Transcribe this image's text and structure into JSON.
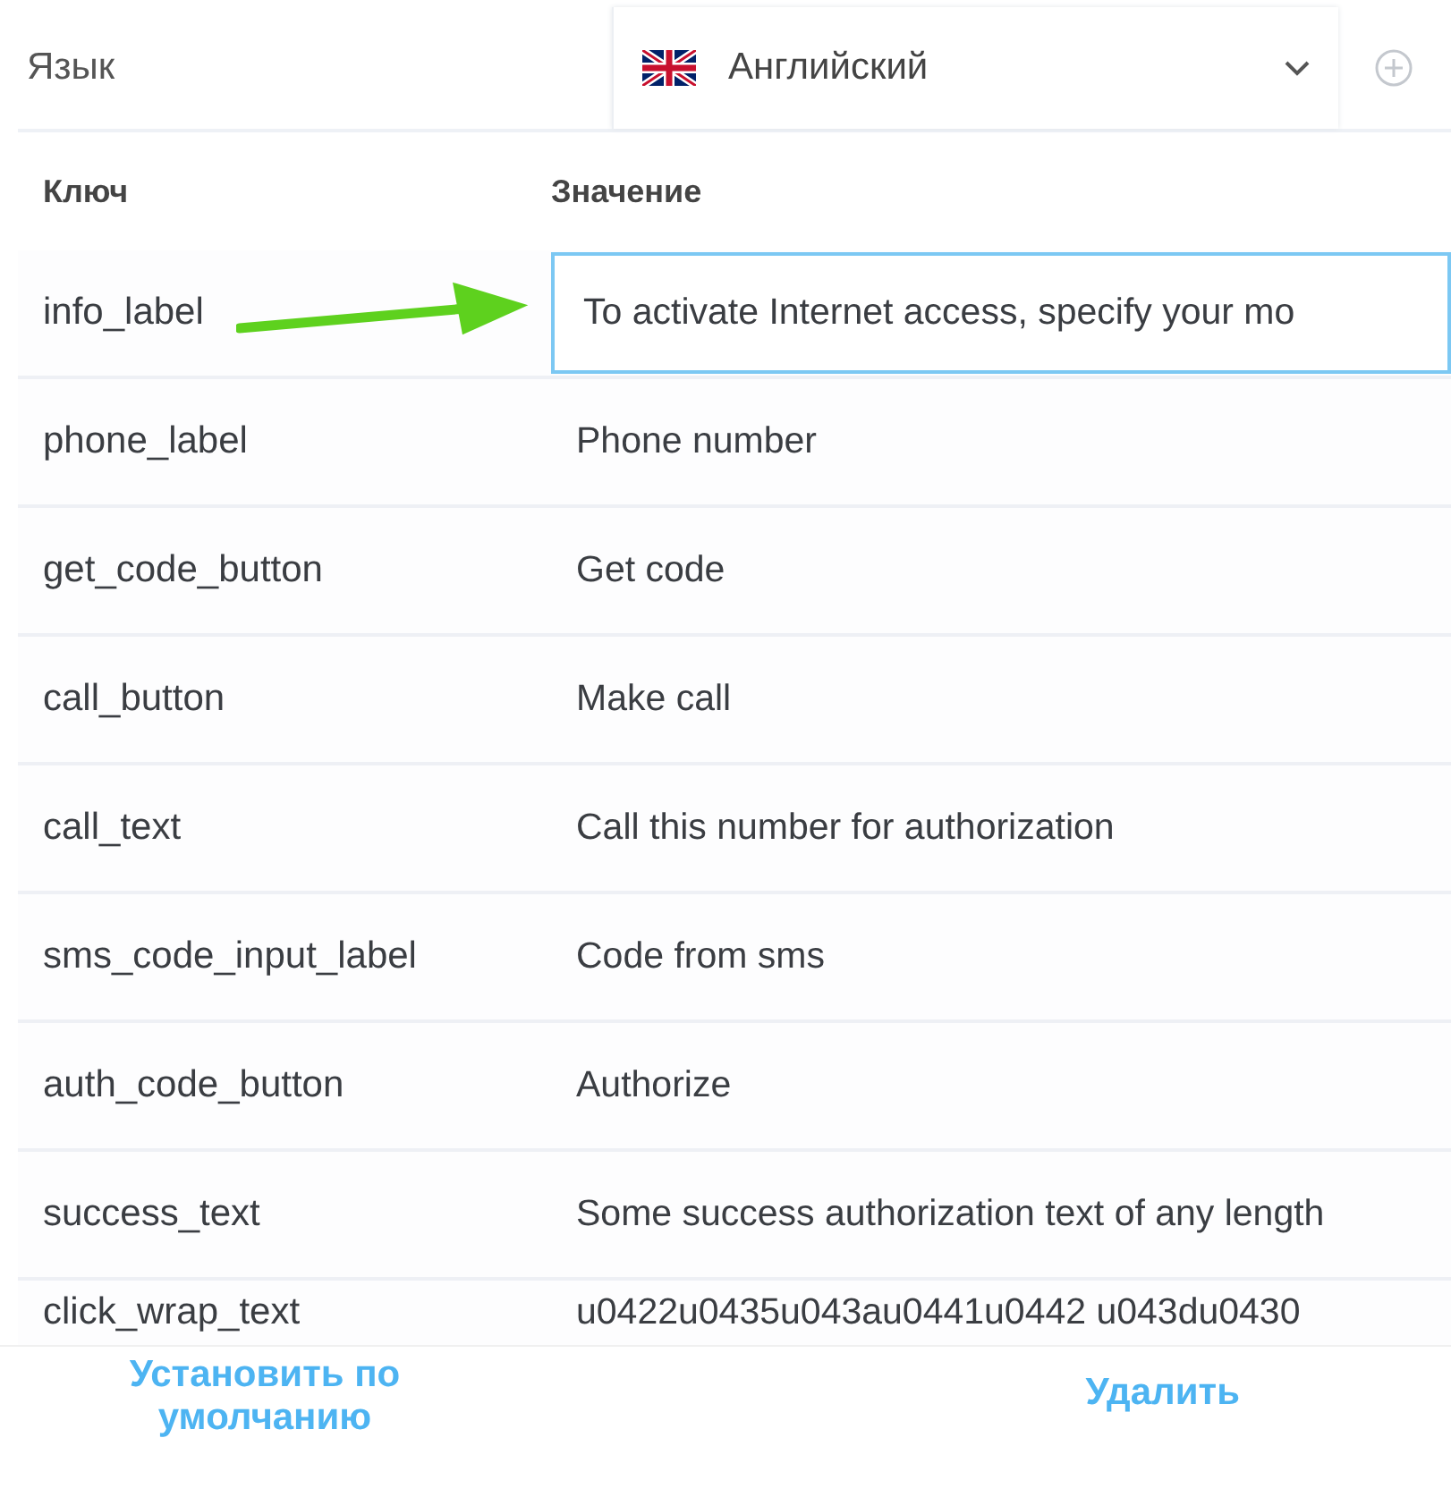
{
  "language": {
    "label": "Язык",
    "value": "Английский"
  },
  "table": {
    "columns": [
      "Ключ",
      "Значение"
    ],
    "rows": [
      {
        "key": "info_label",
        "value": "To activate Internet access, specify your mo",
        "kind": "input",
        "selected": true
      },
      {
        "key": "phone_label",
        "value": "Phone number",
        "kind": "text",
        "selected": false
      },
      {
        "key": "get_code_button",
        "value": "Get code",
        "kind": "text",
        "selected": false
      },
      {
        "key": "call_button",
        "value": "Make call",
        "kind": "text",
        "selected": false
      },
      {
        "key": "call_text",
        "value": "Call this number for authorization",
        "kind": "text",
        "selected": false
      },
      {
        "key": "sms_code_input_label",
        "value": "Code from sms",
        "kind": "text",
        "selected": false
      },
      {
        "key": "auth_code_button",
        "value": "Authorize",
        "kind": "text",
        "selected": false
      },
      {
        "key": "success_text",
        "value": "Some success authorization text of any length",
        "kind": "text",
        "selected": false
      },
      {
        "key": "click_wrap_text",
        "value": "u0422u0435u043au0441u0442 u043du0430",
        "kind": "text",
        "selected": false
      }
    ]
  },
  "footer": {
    "buttons": [
      "Установить по умолчанию",
      "Удалить"
    ]
  }
}
